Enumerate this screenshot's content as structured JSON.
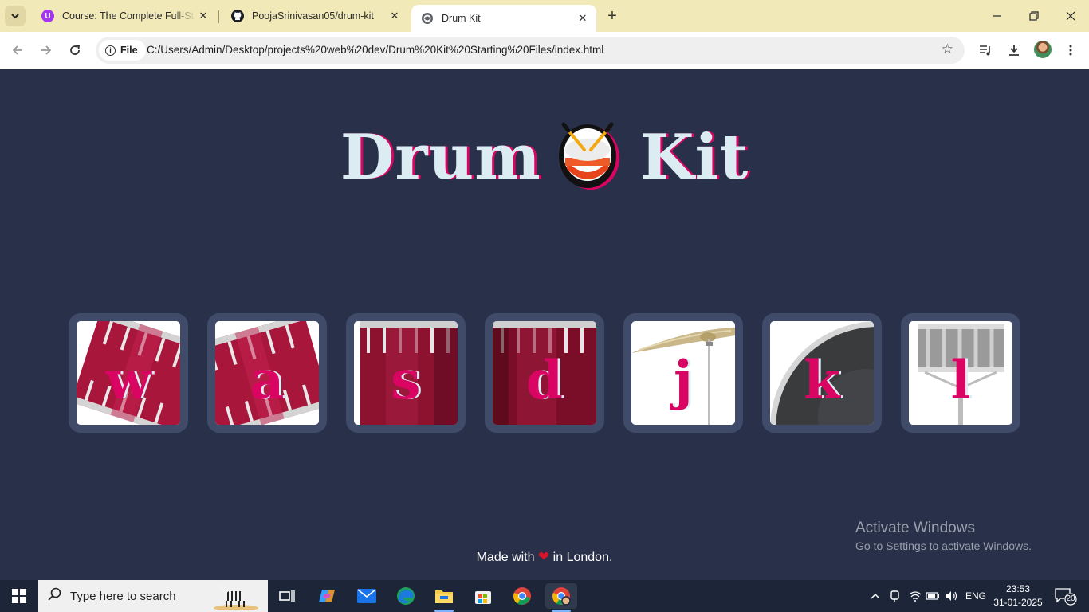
{
  "browser": {
    "tabs": [
      {
        "title": "Course: The Complete Full-Stack",
        "favicon": "udemy-icon",
        "active": false
      },
      {
        "title": "PoojaSrinivasan05/drum-kit",
        "favicon": "github-icon",
        "active": false
      },
      {
        "title": "Drum Kit",
        "favicon": "globe-icon",
        "active": true
      }
    ],
    "address": {
      "scheme_label": "File",
      "url": "C:/Users/Admin/Desktop/projects%20web%20dev/Drum%20Kit%20Starting%20Files/index.html"
    }
  },
  "page": {
    "title_left": "Drum",
    "title_right": "Kit",
    "drums": [
      {
        "letter": "w",
        "image": "tom-drum"
      },
      {
        "letter": "a",
        "image": "tom-drum"
      },
      {
        "letter": "s",
        "image": "tom-drum"
      },
      {
        "letter": "d",
        "image": "tom-drum"
      },
      {
        "letter": "j",
        "image": "crash-cymbal"
      },
      {
        "letter": "k",
        "image": "kick-drum"
      },
      {
        "letter": "l",
        "image": "snare-drum"
      }
    ],
    "footer": {
      "before": "Made with",
      "heart": "❤",
      "after": "in London."
    },
    "watermark": {
      "line1": "Activate Windows",
      "line2": "Go to Settings to activate Windows."
    }
  },
  "taskbar": {
    "search_placeholder": "Type here to search",
    "language": "ENG",
    "time": "23:53",
    "date": "31-01-2025",
    "notification_count": "20"
  },
  "colors": {
    "page_bg": "#283149",
    "drum_border": "#404b69",
    "accent_pink": "#da0463",
    "title_text": "#dbedf3",
    "tabstrip_bg": "#f1e9b8"
  }
}
